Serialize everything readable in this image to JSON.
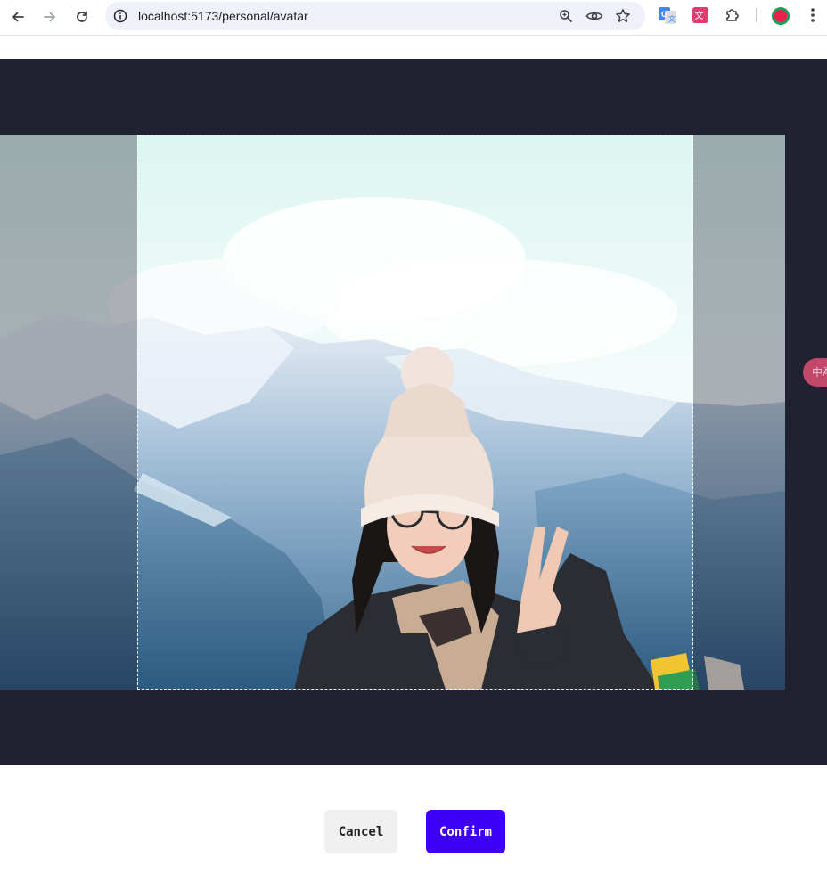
{
  "browser": {
    "url": "localhost:5173/personal/avatar",
    "nav_icons": [
      "back-icon",
      "forward-icon",
      "reload-icon"
    ],
    "omnibox_icons": [
      "site-info-icon",
      "zoom-icon",
      "eye-icon",
      "bookmark-star-icon"
    ],
    "extension_icons": [
      "google-translate-icon",
      "translate-extension-icon",
      "puzzle-extensions-icon",
      "profile-avatar-icon",
      "menu-kebab-icon"
    ]
  },
  "cropper": {
    "floating_translate_label": "中Ä"
  },
  "actions": {
    "cancel_label": "Cancel",
    "confirm_label": "Confirm"
  },
  "colors": {
    "cropper_background": "#202232",
    "confirm_button": "#3d00f5",
    "cancel_button": "#f0f0f0"
  }
}
